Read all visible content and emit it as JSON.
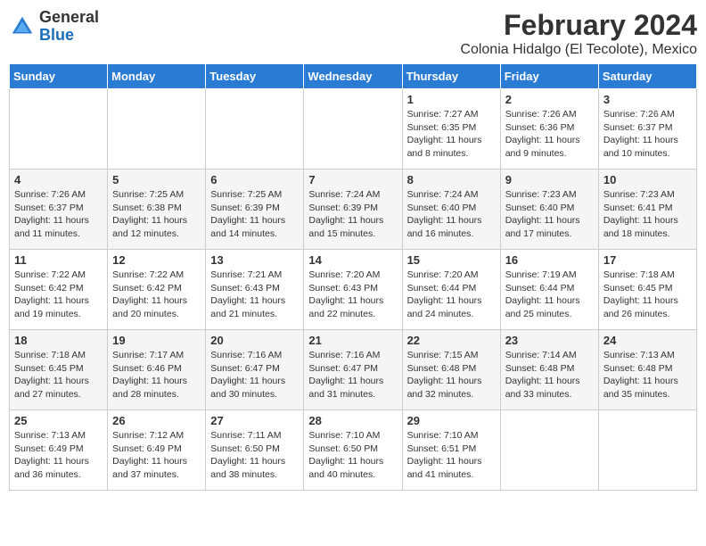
{
  "header": {
    "logo": {
      "line1": "General",
      "line2": "Blue"
    },
    "month_year": "February 2024",
    "subtitle": "Colonia Hidalgo (El Tecolote), Mexico"
  },
  "weekdays": [
    "Sunday",
    "Monday",
    "Tuesday",
    "Wednesday",
    "Thursday",
    "Friday",
    "Saturday"
  ],
  "weeks": [
    [
      {
        "day": "",
        "info": ""
      },
      {
        "day": "",
        "info": ""
      },
      {
        "day": "",
        "info": ""
      },
      {
        "day": "",
        "info": ""
      },
      {
        "day": "1",
        "info": "Sunrise: 7:27 AM\nSunset: 6:35 PM\nDaylight: 11 hours\nand 8 minutes."
      },
      {
        "day": "2",
        "info": "Sunrise: 7:26 AM\nSunset: 6:36 PM\nDaylight: 11 hours\nand 9 minutes."
      },
      {
        "day": "3",
        "info": "Sunrise: 7:26 AM\nSunset: 6:37 PM\nDaylight: 11 hours\nand 10 minutes."
      }
    ],
    [
      {
        "day": "4",
        "info": "Sunrise: 7:26 AM\nSunset: 6:37 PM\nDaylight: 11 hours\nand 11 minutes."
      },
      {
        "day": "5",
        "info": "Sunrise: 7:25 AM\nSunset: 6:38 PM\nDaylight: 11 hours\nand 12 minutes."
      },
      {
        "day": "6",
        "info": "Sunrise: 7:25 AM\nSunset: 6:39 PM\nDaylight: 11 hours\nand 14 minutes."
      },
      {
        "day": "7",
        "info": "Sunrise: 7:24 AM\nSunset: 6:39 PM\nDaylight: 11 hours\nand 15 minutes."
      },
      {
        "day": "8",
        "info": "Sunrise: 7:24 AM\nSunset: 6:40 PM\nDaylight: 11 hours\nand 16 minutes."
      },
      {
        "day": "9",
        "info": "Sunrise: 7:23 AM\nSunset: 6:40 PM\nDaylight: 11 hours\nand 17 minutes."
      },
      {
        "day": "10",
        "info": "Sunrise: 7:23 AM\nSunset: 6:41 PM\nDaylight: 11 hours\nand 18 minutes."
      }
    ],
    [
      {
        "day": "11",
        "info": "Sunrise: 7:22 AM\nSunset: 6:42 PM\nDaylight: 11 hours\nand 19 minutes."
      },
      {
        "day": "12",
        "info": "Sunrise: 7:22 AM\nSunset: 6:42 PM\nDaylight: 11 hours\nand 20 minutes."
      },
      {
        "day": "13",
        "info": "Sunrise: 7:21 AM\nSunset: 6:43 PM\nDaylight: 11 hours\nand 21 minutes."
      },
      {
        "day": "14",
        "info": "Sunrise: 7:20 AM\nSunset: 6:43 PM\nDaylight: 11 hours\nand 22 minutes."
      },
      {
        "day": "15",
        "info": "Sunrise: 7:20 AM\nSunset: 6:44 PM\nDaylight: 11 hours\nand 24 minutes."
      },
      {
        "day": "16",
        "info": "Sunrise: 7:19 AM\nSunset: 6:44 PM\nDaylight: 11 hours\nand 25 minutes."
      },
      {
        "day": "17",
        "info": "Sunrise: 7:18 AM\nSunset: 6:45 PM\nDaylight: 11 hours\nand 26 minutes."
      }
    ],
    [
      {
        "day": "18",
        "info": "Sunrise: 7:18 AM\nSunset: 6:45 PM\nDaylight: 11 hours\nand 27 minutes."
      },
      {
        "day": "19",
        "info": "Sunrise: 7:17 AM\nSunset: 6:46 PM\nDaylight: 11 hours\nand 28 minutes."
      },
      {
        "day": "20",
        "info": "Sunrise: 7:16 AM\nSunset: 6:47 PM\nDaylight: 11 hours\nand 30 minutes."
      },
      {
        "day": "21",
        "info": "Sunrise: 7:16 AM\nSunset: 6:47 PM\nDaylight: 11 hours\nand 31 minutes."
      },
      {
        "day": "22",
        "info": "Sunrise: 7:15 AM\nSunset: 6:48 PM\nDaylight: 11 hours\nand 32 minutes."
      },
      {
        "day": "23",
        "info": "Sunrise: 7:14 AM\nSunset: 6:48 PM\nDaylight: 11 hours\nand 33 minutes."
      },
      {
        "day": "24",
        "info": "Sunrise: 7:13 AM\nSunset: 6:48 PM\nDaylight: 11 hours\nand 35 minutes."
      }
    ],
    [
      {
        "day": "25",
        "info": "Sunrise: 7:13 AM\nSunset: 6:49 PM\nDaylight: 11 hours\nand 36 minutes."
      },
      {
        "day": "26",
        "info": "Sunrise: 7:12 AM\nSunset: 6:49 PM\nDaylight: 11 hours\nand 37 minutes."
      },
      {
        "day": "27",
        "info": "Sunrise: 7:11 AM\nSunset: 6:50 PM\nDaylight: 11 hours\nand 38 minutes."
      },
      {
        "day": "28",
        "info": "Sunrise: 7:10 AM\nSunset: 6:50 PM\nDaylight: 11 hours\nand 40 minutes."
      },
      {
        "day": "29",
        "info": "Sunrise: 7:10 AM\nSunset: 6:51 PM\nDaylight: 11 hours\nand 41 minutes."
      },
      {
        "day": "",
        "info": ""
      },
      {
        "day": "",
        "info": ""
      }
    ]
  ]
}
